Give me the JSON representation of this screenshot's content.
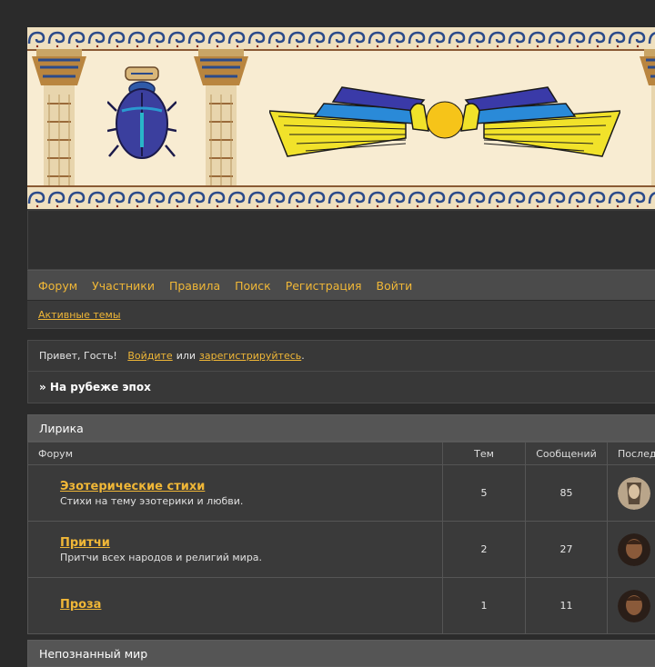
{
  "colors": {
    "accent": "#f0b737",
    "page_bg": "#2b2b2b",
    "panel": "#3a3a3a",
    "header": "#555555"
  },
  "nav": {
    "items": [
      "Форум",
      "Участники",
      "Правила",
      "Поиск",
      "Регистрация",
      "Войти"
    ],
    "active_topics": "Активные темы"
  },
  "welcome": {
    "greeting": "Привет, Гость!",
    "login_link": "Войдите",
    "or": "или",
    "register_link": "зарегистрируйтесь",
    "period": ".",
    "breadcrumb": "» На рубеже эпох"
  },
  "category": {
    "title": "Лирика",
    "columns": {
      "forum": "Форум",
      "topics": "Тем",
      "posts": "Сообщений",
      "last": "Послед"
    },
    "forums": [
      {
        "title": "Эзотерические стихи",
        "desc": "Стихи на тему эзотерики и любви.",
        "topics": "5",
        "posts": "85",
        "avatar": "avatar-icon"
      },
      {
        "title": "Притчи",
        "desc": "Притчи всех народов и религий мира.",
        "topics": "2",
        "posts": "27",
        "avatar": "avatar-icon"
      },
      {
        "title": "Проза",
        "desc": "",
        "topics": "1",
        "posts": "11",
        "avatar": "avatar-icon"
      }
    ]
  },
  "next_category": {
    "title": "Непознанный мир"
  }
}
